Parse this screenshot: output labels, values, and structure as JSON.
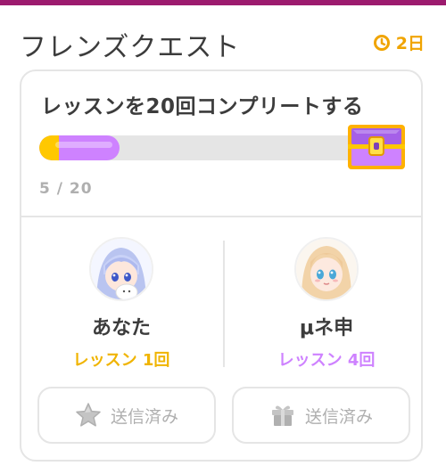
{
  "header": {
    "title": "フレンズクエスト",
    "timer_value": "2日"
  },
  "quest": {
    "title": "レッスンを20回コンプリートする",
    "progress_text": "5 / 20",
    "current": 5,
    "target": 20
  },
  "friends": [
    {
      "name": "あなた",
      "lessons": "レッスン 1回",
      "color": "#f0b400"
    },
    {
      "name": "μネ申",
      "lessons": "レッスン 4回",
      "color": "#ce82ff"
    }
  ],
  "actions": {
    "left_label": "送信済み",
    "right_label": "送信済み"
  },
  "colors": {
    "accent_gold": "#f0a400",
    "accent_purple": "#ce82ff",
    "top_bar": "#9c1b6e",
    "muted": "#afafaf"
  },
  "icons": [
    "clock-icon",
    "treasure-chest-icon",
    "star-icon",
    "gift-icon"
  ]
}
